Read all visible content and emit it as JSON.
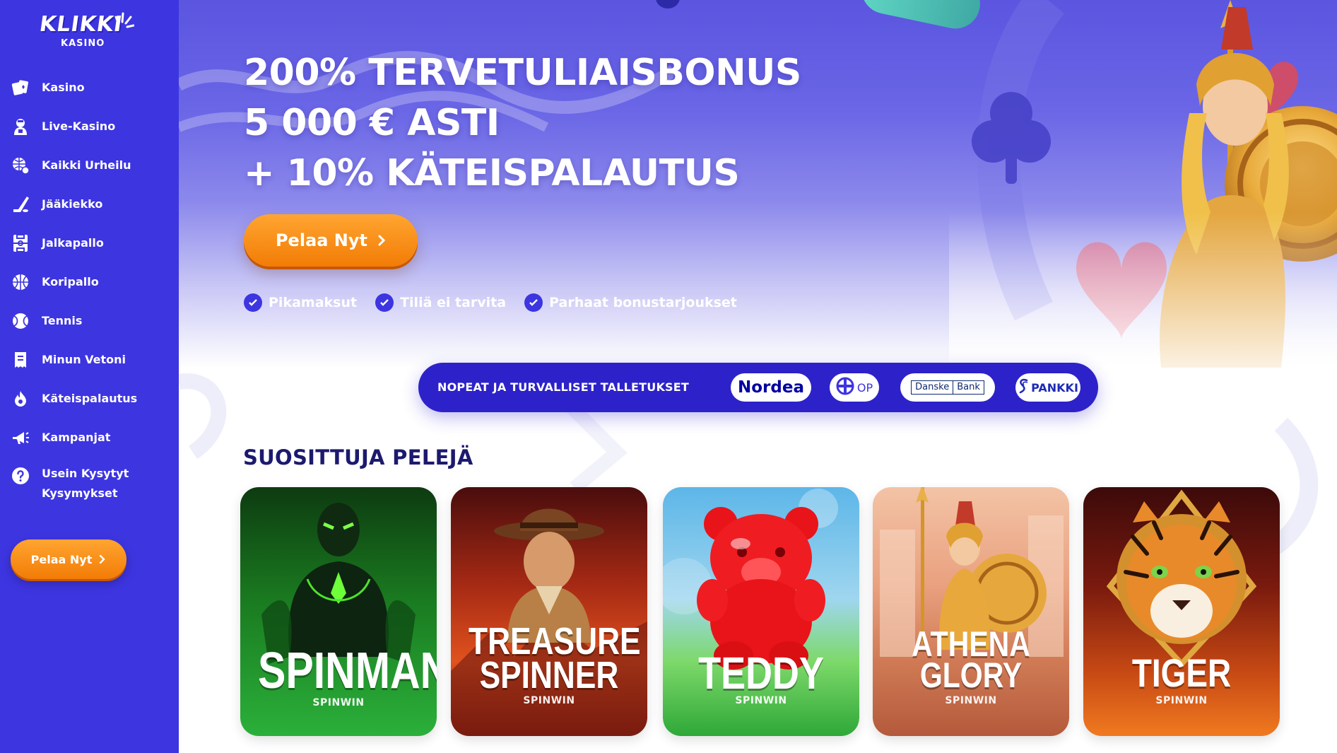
{
  "brand": {
    "logo_word": "KLIKKI",
    "logo_sub": "KASINO",
    "accent": "#3d35e0",
    "cta_orange": "#f28c12",
    "title_navy": "#1c1a6e"
  },
  "sidebar": {
    "items": [
      {
        "label": "Kasino",
        "icon": "cards-icon"
      },
      {
        "label": "Live-Kasino",
        "icon": "dealer-icon"
      },
      {
        "label": "Kaikki Urheilu",
        "icon": "globe-ball-icon"
      },
      {
        "label": "Jääkiekko",
        "icon": "hockey-stick-icon"
      },
      {
        "label": "Jalkapallo",
        "icon": "football-pitch-icon"
      },
      {
        "label": "Koripallo",
        "icon": "basketball-icon"
      },
      {
        "label": "Tennis",
        "icon": "tennis-ball-icon"
      },
      {
        "label": "Minun Vetoni",
        "icon": "betslip-icon"
      },
      {
        "label": "Käteispalautus",
        "icon": "cashback-flame-icon"
      },
      {
        "label": "Kampanjat",
        "icon": "megaphone-icon"
      },
      {
        "label": "Usein Kysytyt Kysymykset",
        "label_line1": "Usein Kysytyt",
        "label_line2": "Kysymykset",
        "icon": "question-icon"
      }
    ],
    "cta_label": "Pelaa Nyt"
  },
  "hero": {
    "line1": "200% TERVETULIAISBONUS",
    "line2": "5 000 € ASTI",
    "line3": "+ 10% KÄTEISPALAUTUS",
    "cta_label": "Pelaa Nyt",
    "features": [
      "Pikamaksut",
      "Tiliä ei tarvita",
      "Parhaat bonustarjoukset"
    ]
  },
  "banks": {
    "title": "NOPEAT JA TURVALLISET TALLETUKSET",
    "nordea": "Nordea",
    "op": "OP",
    "danske_1": "Danske",
    "danske_2": "Bank",
    "spankki": "PANKKI"
  },
  "games": {
    "title": "SUOSITTUJA PELEJÄ",
    "items": [
      {
        "line1": "SPINMAN",
        "line2": "",
        "provider": "SPINWIN"
      },
      {
        "line1": "TREASURE",
        "line2": "SPINNER",
        "provider": "SPINWIN"
      },
      {
        "line1": "TEDDY",
        "line2": "",
        "provider": "SPINWIN"
      },
      {
        "line1": "ATHENA",
        "line2": "GLORY",
        "provider": "SPINWIN"
      },
      {
        "line1": "TIGER",
        "line2": "",
        "provider": "SPINWIN"
      }
    ]
  }
}
